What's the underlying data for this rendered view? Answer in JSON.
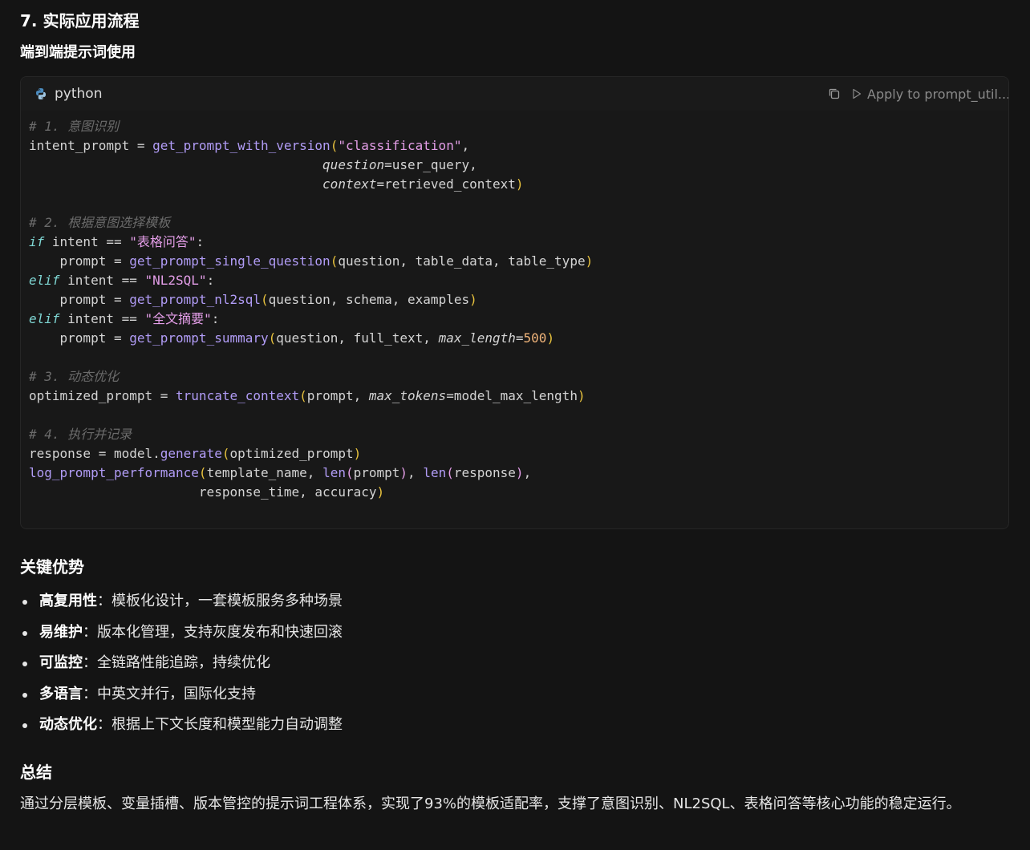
{
  "section_title": "7. 实际应用流程",
  "sub_title": "端到端提示词使用",
  "code_block": {
    "language": "python",
    "language_icon": "python-icon",
    "copy_icon": "copy-icon",
    "apply_label": "Apply to prompt_util....",
    "lines": [
      [
        [
          "c",
          "# 1. 意图识别"
        ]
      ],
      [
        [
          "pl",
          "intent_prompt = "
        ],
        [
          "fn",
          "get_prompt_with_version"
        ],
        [
          "br",
          "("
        ],
        [
          "st",
          "\"classification\""
        ],
        [
          "pl",
          ","
        ]
      ],
      [
        [
          "pl",
          "                                      "
        ],
        [
          "pa",
          "question"
        ],
        [
          "pl",
          "=user_query,"
        ]
      ],
      [
        [
          "pl",
          "                                      "
        ],
        [
          "pa",
          "context"
        ],
        [
          "pl",
          "=retrieved_context"
        ],
        [
          "br",
          ")"
        ]
      ],
      [],
      [
        [
          "c",
          "# 2. 根据意图选择模板"
        ]
      ],
      [
        [
          "kw",
          "if"
        ],
        [
          "pl",
          " intent == "
        ],
        [
          "st",
          "\"表格问答\""
        ],
        [
          "pl",
          ":"
        ]
      ],
      [
        [
          "pl",
          "    prompt = "
        ],
        [
          "fn",
          "get_prompt_single_question"
        ],
        [
          "br",
          "("
        ],
        [
          "pl",
          "question, table_data, table_type"
        ],
        [
          "br",
          ")"
        ]
      ],
      [
        [
          "kw",
          "elif"
        ],
        [
          "pl",
          " intent == "
        ],
        [
          "st",
          "\"NL2SQL\""
        ],
        [
          "pl",
          ":"
        ]
      ],
      [
        [
          "pl",
          "    prompt = "
        ],
        [
          "fn",
          "get_prompt_nl2sql"
        ],
        [
          "br",
          "("
        ],
        [
          "pl",
          "question, schema, examples"
        ],
        [
          "br",
          ")"
        ]
      ],
      [
        [
          "kw",
          "elif"
        ],
        [
          "pl",
          " intent == "
        ],
        [
          "st",
          "\"全文摘要\""
        ],
        [
          "pl",
          ":"
        ]
      ],
      [
        [
          "pl",
          "    prompt = "
        ],
        [
          "fn",
          "get_prompt_summary"
        ],
        [
          "br",
          "("
        ],
        [
          "pl",
          "question, full_text, "
        ],
        [
          "pa",
          "max_length"
        ],
        [
          "pl",
          "="
        ],
        [
          "nu",
          "500"
        ],
        [
          "br",
          ")"
        ]
      ],
      [],
      [
        [
          "c",
          "# 3. 动态优化"
        ]
      ],
      [
        [
          "pl",
          "optimized_prompt = "
        ],
        [
          "fn",
          "truncate_context"
        ],
        [
          "br",
          "("
        ],
        [
          "pl",
          "prompt, "
        ],
        [
          "pa",
          "max_tokens"
        ],
        [
          "pl",
          "=model_max_length"
        ],
        [
          "br",
          ")"
        ]
      ],
      [],
      [
        [
          "c",
          "# 4. 执行并记录"
        ]
      ],
      [
        [
          "pl",
          "response = model."
        ],
        [
          "fn",
          "generate"
        ],
        [
          "br",
          "("
        ],
        [
          "pl",
          "optimized_prompt"
        ],
        [
          "br",
          ")"
        ]
      ],
      [
        [
          "fn",
          "log_prompt_performance"
        ],
        [
          "br",
          "("
        ],
        [
          "pl",
          "template_name, "
        ],
        [
          "fn",
          "len"
        ],
        [
          "st",
          "("
        ],
        [
          "pl",
          "prompt"
        ],
        [
          "st",
          ")"
        ],
        [
          "pl",
          ", "
        ],
        [
          "fn",
          "len"
        ],
        [
          "st",
          "("
        ],
        [
          "pl",
          "response"
        ],
        [
          "st",
          ")"
        ],
        [
          "pl",
          ","
        ]
      ],
      [
        [
          "pl",
          "                      response_time, accuracy"
        ],
        [
          "br",
          ")"
        ]
      ]
    ]
  },
  "advantages": {
    "title": "关键优势",
    "items": [
      {
        "label": "高复用性",
        "text": "：模板化设计，一套模板服务多种场景"
      },
      {
        "label": "易维护",
        "text": "：版本化管理，支持灰度发布和快速回滚"
      },
      {
        "label": "可监控",
        "text": "：全链路性能追踪，持续优化"
      },
      {
        "label": "多语言",
        "text": "：中英文并行，国际化支持"
      },
      {
        "label": "动态优化",
        "text": "：根据上下文长度和模型能力自动调整"
      }
    ]
  },
  "summary": {
    "title": "总结",
    "text": "通过分层模板、变量插槽、版本管控的提示词工程体系，实现了93%的模板适配率，支撑了意图识别、NL2SQL、表格问答等核心功能的稳定运行。"
  }
}
